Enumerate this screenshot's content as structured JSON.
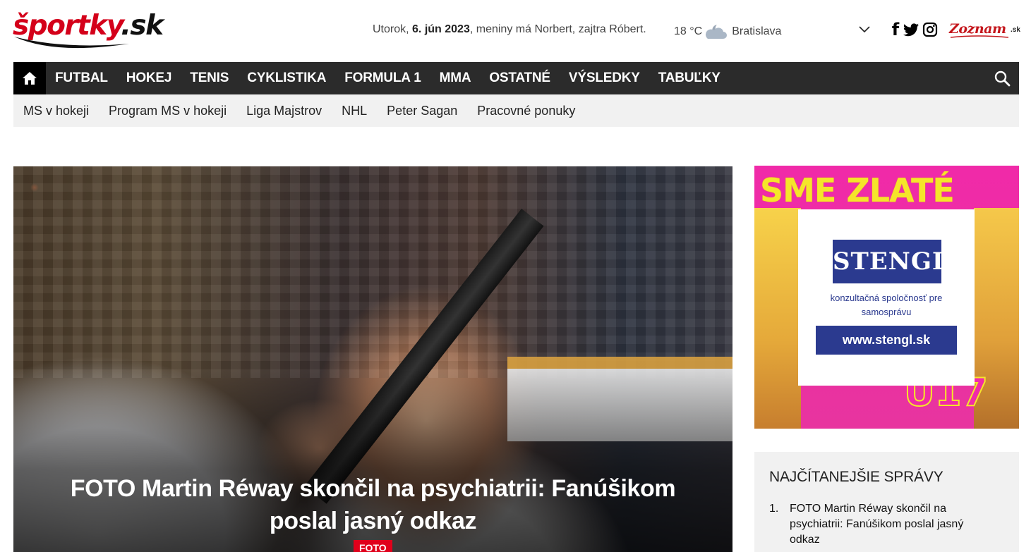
{
  "header": {
    "logo": {
      "part1": "športky",
      "part2": ".sk"
    },
    "date": {
      "day": "Utorok,",
      "date": "6. jún 2023",
      "rest": ", meniny má Norbert, zajtra Róbert."
    },
    "weather": {
      "temp": "18 °C",
      "city": "Bratislava",
      "icon": "partly-cloudy-night-icon"
    },
    "social": {
      "facebook": "f",
      "twitter": "twitter-icon",
      "instagram": "instagram-icon"
    },
    "partner": {
      "name": "Zoznam",
      "suffix": ".sk"
    }
  },
  "mainnav": {
    "items": [
      "FUTBAL",
      "HOKEJ",
      "TENIS",
      "CYKLISTIKA",
      "FORMULA 1",
      "MMA",
      "OSTATNÉ",
      "VÝSLEDKY",
      "TABUĽKY"
    ]
  },
  "subnav": {
    "items": [
      "MS v hokeji",
      "Program MS v hokeji",
      "Liga Majstrov",
      "NHL",
      "Peter Sagan",
      "Pracovné ponuky"
    ]
  },
  "hero": {
    "title": "FOTO Martin Réway skončil na psychiatrii: Fanúšikom poslal jasný odkaz",
    "badge": "FOTO"
  },
  "ad": {
    "headline": "SME ZLATÉ",
    "bottom": "U17",
    "brand": "STENGL",
    "subtitle": "konzultačná spoločnosť pre samosprávu",
    "url": "www.stengl.sk"
  },
  "mostread": {
    "title": "NAJČÍTANEJŠIE SPRÁVY",
    "items": [
      {
        "num": "1.",
        "text": "FOTO Martin Réway skončil na psychiatrii: Fanúšikom poslal jasný odkaz"
      }
    ]
  },
  "colors": {
    "accent": "#e0001b",
    "nav": "#2b2b2b",
    "subnav": "#f1f1f1",
    "ad_brand": "#2b3a8f"
  }
}
